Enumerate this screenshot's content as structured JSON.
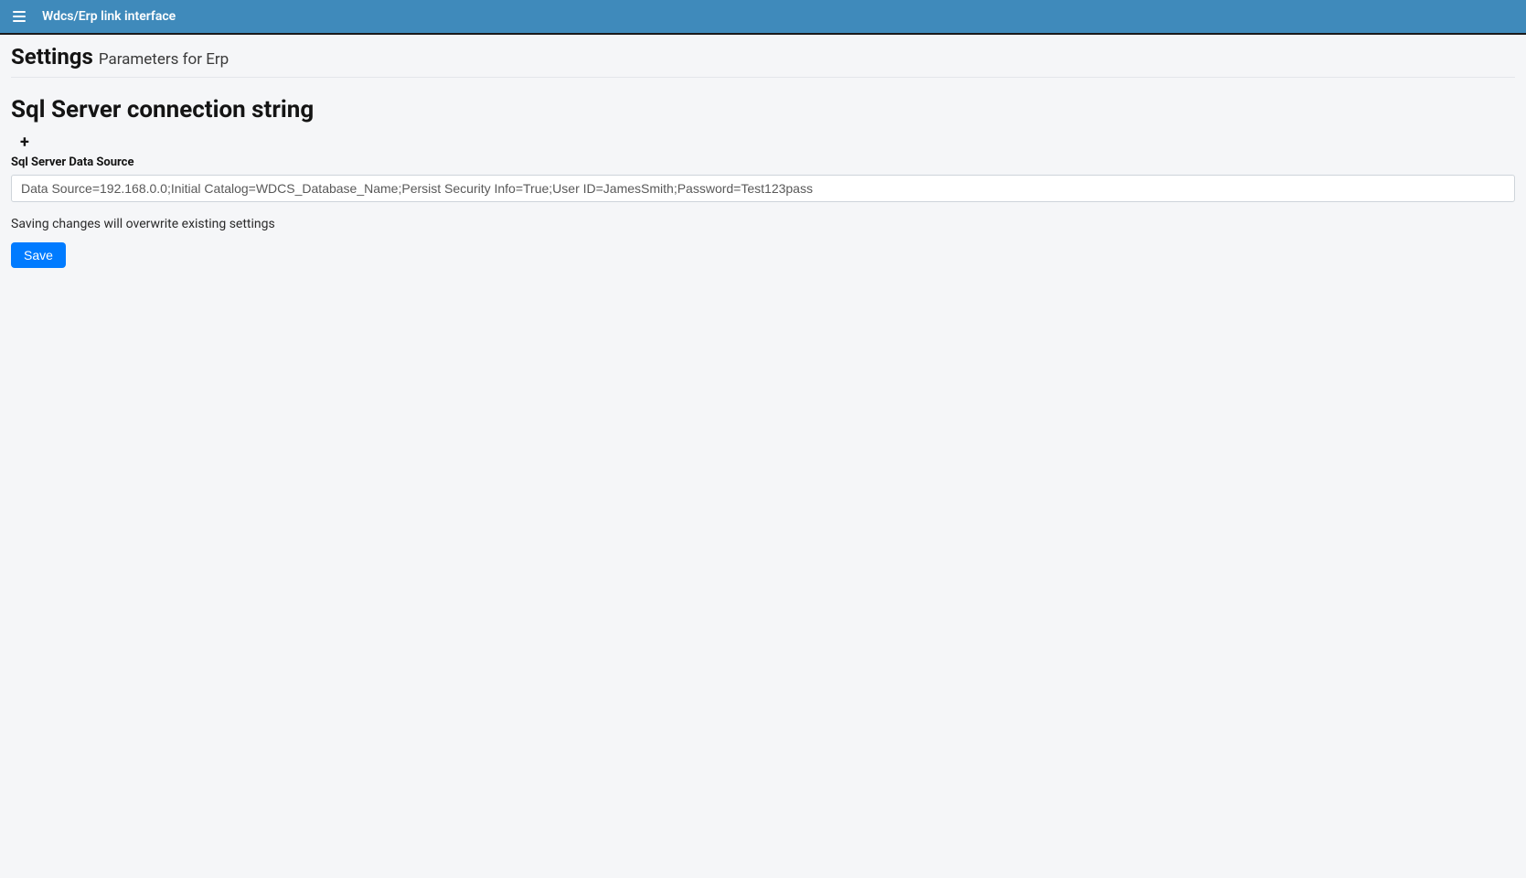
{
  "header": {
    "app_title": "Wdcs/Erp link interface"
  },
  "page": {
    "title": "Settings",
    "subtitle": "Parameters for Erp"
  },
  "section": {
    "heading": "Sql Server connection string",
    "field_label": "Sql Server Data Source",
    "field_value": "Data Source=192.168.0.0;Initial Catalog=WDCS_Database_Name;Persist Security Info=True;User ID=JamesSmith;Password=Test123pass",
    "warning": "Saving changes will overwrite existing settings",
    "save_label": "Save"
  }
}
